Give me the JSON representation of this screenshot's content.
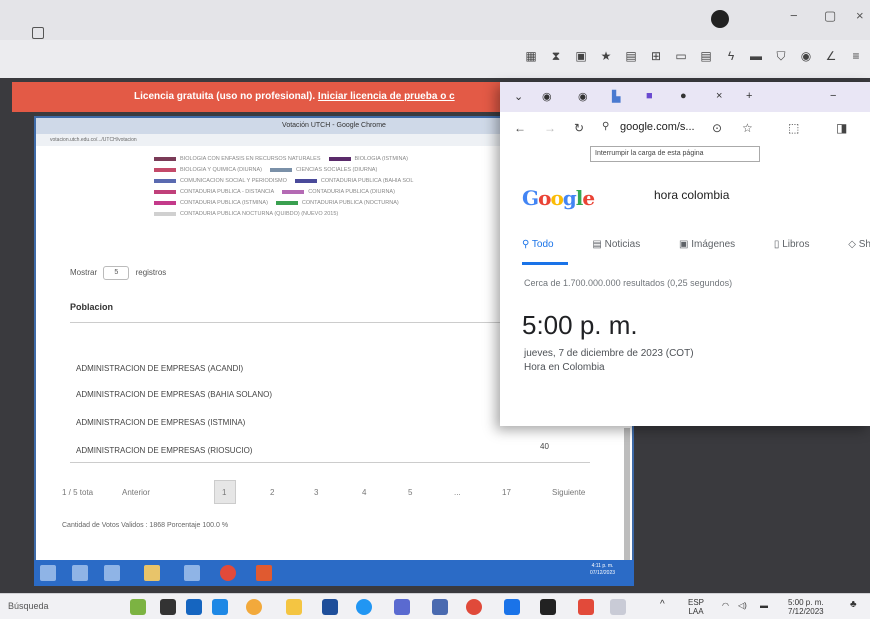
{
  "outer_browser": {
    "minimize": "−",
    "restore": "▢",
    "close": "×"
  },
  "banner": {
    "text": "Licencia gratuita (uso no profesional).",
    "link": "Iniciar licencia de prueba o c"
  },
  "voting_window": {
    "title": "Votación UTCH - Google Chrome",
    "url": "votacion.utch.edu.co/.../UTCH/votacion",
    "legend": [
      {
        "label": "BIOLOGIA CON ENFASIS EN RECURSOS NATURALES",
        "color": "#7a3b57"
      },
      {
        "label": "BIOLOGIA (ISTMINA)",
        "color": "#5a2a6a"
      },
      {
        "label": "BIOLOGIA Y QUIMICA (DIURNA)",
        "color": "#c44a6a"
      },
      {
        "label": "CIENCIAS SOCIALES (DIURNA)",
        "color": "#7a90a8"
      },
      {
        "label": "COMUNICACION SOCIAL Y PERIODISMO",
        "color": "#5a6ab0"
      },
      {
        "label": "CONTADURIA PUBLICA (BAHIA SOL",
        "color": "#4a4a9a"
      },
      {
        "label": "CONTADURIA PUBLICA - DISTANCIA",
        "color": "#c0407a"
      },
      {
        "label": "CONTADURIA PUBLICA (DIURNA)",
        "color": "#b46ab4"
      },
      {
        "label": "CONTADURIA PUBLICA (ISTMINA)",
        "color": "#c43a8a"
      },
      {
        "label": "CONTADURIA PUBLICA (NOCTURNA)",
        "color": "#3aa050"
      },
      {
        "label": "CONTADURIA PUBLICA NOCTURNA (QUIBDO) (NUEVO 2015)",
        "color": "#d0d0d0"
      }
    ],
    "mostrar": "Mostrar",
    "mostrar_value": "5",
    "registros": "registros",
    "column_header": "Poblacion",
    "rows": [
      {
        "name": "ADMINISTRACION DE EMPRESAS (ACANDI)",
        "value": ""
      },
      {
        "name": "ADMINISTRACION DE EMPRESAS (BAHIA SOLANO)",
        "value": ""
      },
      {
        "name": "ADMINISTRACION DE EMPRESAS (ISTMINA)",
        "value": ""
      },
      {
        "name": "ADMINISTRACION DE EMPRESAS (RIOSUCIO)",
        "value": "40"
      }
    ],
    "pager": {
      "info": "1 / 5 tota",
      "prev": "Anterior",
      "pages": [
        "1",
        "2",
        "3",
        "4",
        "5",
        "...",
        "17"
      ],
      "next": "Siguiente"
    },
    "votos": "Cantidad de Votos Validos : 1868 Porcentaje 100.0 %",
    "clock": "4:11 p. m.",
    "date": "07/12/2023"
  },
  "popup": {
    "url": "google.com/s...",
    "tooltip": "Interrumpir la carga de esta página",
    "logo": "Google",
    "query": "hora colombia",
    "tabs": [
      "Todo",
      "Noticias",
      "Imágenes",
      "Libros",
      "Shop"
    ],
    "results_count": "Cerca de 1.700.000.000 resultados (0,25 segundos)",
    "time": "5:00 p. m.",
    "date": "jueves, 7 de diciembre de 2023 (COT)",
    "place": "Hora en Colombia"
  },
  "taskbar": {
    "search": "Búsqueda",
    "lang_top": "ESP",
    "lang_bottom": "LAA",
    "time": "5:00 p. m.",
    "date": "7/12/2023"
  },
  "colors": {
    "banner": "#e35a46",
    "google_blue": "#1a73e8",
    "inner_taskbar": "#2b6bc6"
  }
}
